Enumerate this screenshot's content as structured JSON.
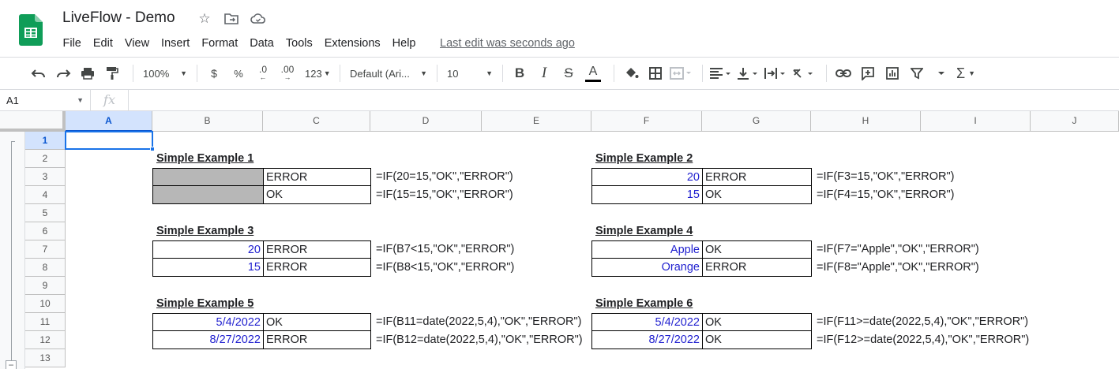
{
  "app": {
    "title": "LiveFlow - Demo",
    "menus": [
      "File",
      "Edit",
      "View",
      "Insert",
      "Format",
      "Data",
      "Tools",
      "Extensions",
      "Help"
    ],
    "last_edit": "Last edit was seconds ago",
    "icons": [
      "star-icon",
      "move-to-folder-icon",
      "cloud-status-icon"
    ]
  },
  "toolbar": {
    "zoom": "100%",
    "currency": "$",
    "percent": "%",
    "decrease_decimal": ".0",
    "increase_decimal": ".00",
    "more_formats": "123",
    "font": "Default (Ari...",
    "font_size": "10",
    "bold": "B",
    "italic": "I",
    "strikethrough": "S",
    "text_color": "A",
    "sum": "Σ"
  },
  "formula_bar": {
    "name_box": "A1",
    "fx": "fx",
    "content": ""
  },
  "columns": [
    "A",
    "B",
    "C",
    "D",
    "E",
    "F",
    "G",
    "H",
    "I",
    "J"
  ],
  "rows": [
    "1",
    "2",
    "3",
    "4",
    "5",
    "6",
    "7",
    "8",
    "9",
    "10",
    "11",
    "12",
    "13"
  ],
  "selected_cell": "A1",
  "colors": {
    "input_blue": "#1f1fcf",
    "gray_fill": "#b7b7b7",
    "selection": "#1a73e8",
    "sheets_green": "#0f9d58"
  },
  "examples": [
    {
      "title": "Simple Example 1",
      "rows": [
        {
          "input": "",
          "result": "ERROR",
          "formula": "=IF(20=15,\"OK\",\"ERROR\")"
        },
        {
          "input": "",
          "result": "OK",
          "formula": "=IF(15=15,\"OK\",\"ERROR\")"
        }
      ]
    },
    {
      "title": "Simple Example 2",
      "rows": [
        {
          "input": "20",
          "result": "ERROR",
          "formula": "=IF(F3=15,\"OK\",\"ERROR\")"
        },
        {
          "input": "15",
          "result": "OK",
          "formula": "=IF(F4=15,\"OK\",\"ERROR\")"
        }
      ]
    },
    {
      "title": "Simple Example 3",
      "rows": [
        {
          "input": "20",
          "result": "ERROR",
          "formula": "=IF(B7<15,\"OK\",\"ERROR\")"
        },
        {
          "input": "15",
          "result": "ERROR",
          "formula": "=IF(B8<15,\"OK\",\"ERROR\")"
        }
      ]
    },
    {
      "title": "Simple Example 4",
      "rows": [
        {
          "input": "Apple",
          "result": "OK",
          "formula": "=IF(F7=\"Apple\",\"OK\",\"ERROR\")"
        },
        {
          "input": "Orange",
          "result": "ERROR",
          "formula": "=IF(F8=\"Apple\",\"OK\",\"ERROR\")"
        }
      ]
    },
    {
      "title": "Simple Example 5",
      "rows": [
        {
          "input": "5/4/2022",
          "result": "OK",
          "formula": "=IF(B11=date(2022,5,4),\"OK\",\"ERROR\")"
        },
        {
          "input": "8/27/2022",
          "result": "ERROR",
          "formula": "=IF(B12=date(2022,5,4),\"OK\",\"ERROR\")"
        }
      ]
    },
    {
      "title": "Simple Example 6",
      "rows": [
        {
          "input": "5/4/2022",
          "result": "OK",
          "formula": "=IF(F11>=date(2022,5,4),\"OK\",\"ERROR\")"
        },
        {
          "input": "8/27/2022",
          "result": "OK",
          "formula": "=IF(F12>=date(2022,5,4),\"OK\",\"ERROR\")"
        }
      ]
    }
  ]
}
